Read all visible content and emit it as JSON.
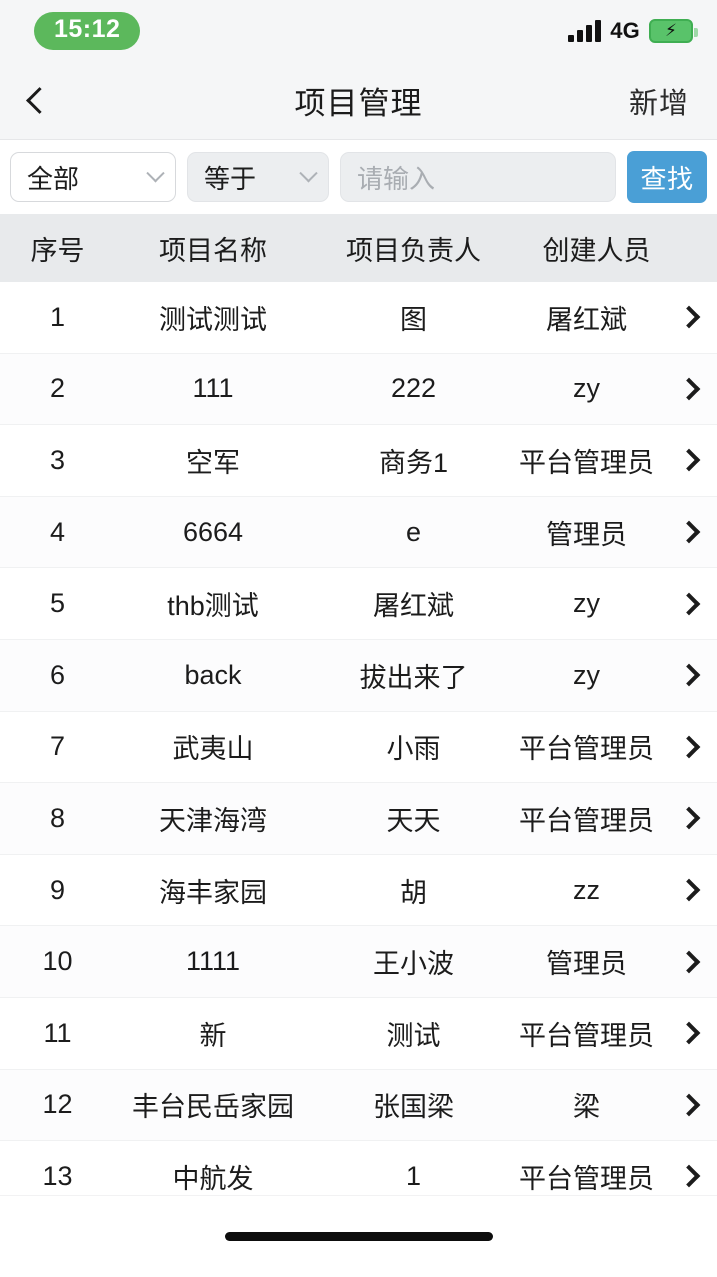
{
  "status_bar": {
    "time": "15:12",
    "network": "4G",
    "time_pill_color": "#5cb85c",
    "battery_color": "#59c36a",
    "battery_state": "charging"
  },
  "nav_bar": {
    "back_icon": "chevron-left-icon",
    "title": "项目管理",
    "action_label": "新增"
  },
  "filter_bar": {
    "field_select": {
      "value": "全部",
      "icon": "chevron-down-icon"
    },
    "operator_select": {
      "value": "等于",
      "icon": "chevron-down-icon"
    },
    "keyword_input": {
      "value": "",
      "placeholder": "请输入"
    },
    "search_button": {
      "label": "查找",
      "color": "#4a9fd6"
    }
  },
  "table": {
    "columns": [
      "序号",
      "项目名称",
      "项目负责人",
      "创建人员"
    ],
    "header_bg": "#e8eaec",
    "row_arrow_icon": "chevron-right-icon",
    "rows": [
      {
        "index": "1",
        "name": "测试测试",
        "owner": "图",
        "creator": "屠红斌"
      },
      {
        "index": "2",
        "name": "111",
        "owner": "222",
        "creator": "zy"
      },
      {
        "index": "3",
        "name": "空军",
        "owner": "商务1",
        "creator": "平台管理员"
      },
      {
        "index": "4",
        "name": "6664",
        "owner": "e",
        "creator": "管理员"
      },
      {
        "index": "5",
        "name": "thb测试",
        "owner": "屠红斌",
        "creator": "zy"
      },
      {
        "index": "6",
        "name": "back",
        "owner": "拔出来了",
        "creator": "zy"
      },
      {
        "index": "7",
        "name": "武夷山",
        "owner": "小雨",
        "creator": "平台管理员"
      },
      {
        "index": "8",
        "name": "天津海湾",
        "owner": "天天",
        "creator": "平台管理员"
      },
      {
        "index": "9",
        "name": "海丰家园",
        "owner": "胡",
        "creator": "zz"
      },
      {
        "index": "10",
        "name": "1111",
        "owner": "王小波",
        "creator": "管理员"
      },
      {
        "index": "11",
        "name": "新",
        "owner": "测试",
        "creator": "平台管理员"
      },
      {
        "index": "12",
        "name": "丰台民岳家园",
        "owner": "张国梁",
        "creator": "梁"
      },
      {
        "index": "13",
        "name": "中航发",
        "owner": "1",
        "creator": "平台管理员"
      }
    ]
  },
  "home_indicator": {
    "icon": "home-indicator-bar"
  }
}
